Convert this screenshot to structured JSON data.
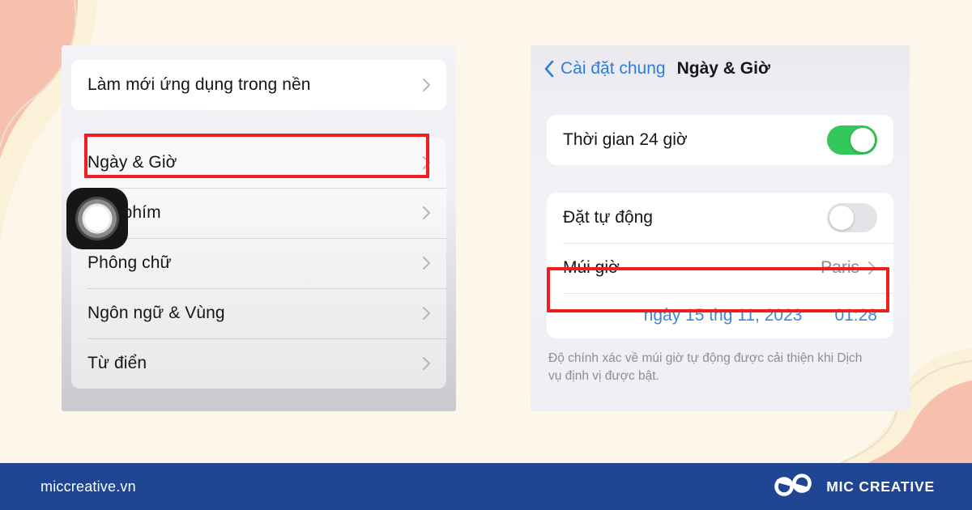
{
  "background": {
    "page_color": "#FDF7EB",
    "blob_peach": "#F6C0AC",
    "blob_cream": "#FBF0D8",
    "highlight_color": "#F01F1F"
  },
  "left_panel": {
    "name": "iOS General settings list",
    "groups": [
      {
        "rows": [
          {
            "label": "Làm mới ứng dụng trong nền",
            "accessory": "chevron-right-icon"
          }
        ]
      },
      {
        "rows": [
          {
            "label": "Ngày & Giờ",
            "accessory": "chevron-right-icon",
            "highlighted": true
          },
          {
            "label": "Bàn phím",
            "accessory": "chevron-right-icon",
            "occluded": true
          },
          {
            "label": "Phông chữ",
            "accessory": "chevron-right-icon"
          },
          {
            "label": "Ngôn ngữ & Vùng",
            "accessory": "chevron-right-icon"
          },
          {
            "label": "Từ điển",
            "accessory": "chevron-right-icon"
          }
        ]
      }
    ],
    "overlay_icon": "camera-lens-icon"
  },
  "right_panel": {
    "name": "iOS Date & Time settings",
    "nav": {
      "back_icon": "chevron-left-icon",
      "back_label": "Cài đặt chung",
      "title": "Ngày & Giờ"
    },
    "group_one": {
      "rows": [
        {
          "label": "Thời gian 24 giờ",
          "control": "toggle",
          "state": "on"
        }
      ]
    },
    "group_two": {
      "rows": [
        {
          "label": "Đặt tự động",
          "control": "toggle",
          "state": "off"
        },
        {
          "label": "Múi giờ",
          "value": "Paris",
          "accessory": "chevron-right-icon",
          "highlighted": true
        }
      ],
      "datetime": {
        "date": "ngày 15 thg 11, 2023",
        "time": "01:28"
      }
    },
    "footnote": "Độ chính xác về múi giờ tự động được cải thiện khi Dịch vụ định vị được bật.",
    "toggle_on_color": "#34C759",
    "toggle_off_color": "#E4E4E8",
    "link_color": "#2F7DD7"
  },
  "brandbar": {
    "url": "miccreative.vn",
    "logo_icon": "infinity-loops-logo",
    "brand_name": "MIC CREATIVE",
    "bar_color": "#1F4593"
  }
}
